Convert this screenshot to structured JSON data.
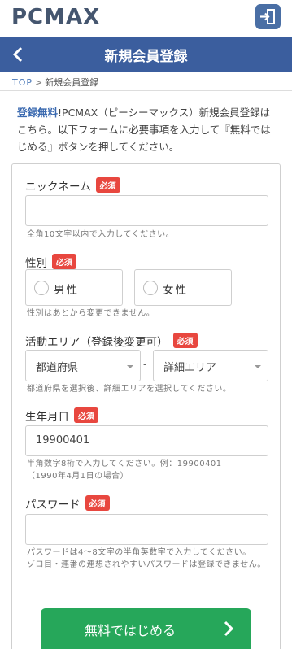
{
  "brand": {
    "logo_text": "PCMAX",
    "accent_color": "#3b5e9e",
    "submit_color": "#26a75a",
    "required_color": "#e8473f"
  },
  "header": {
    "title": "新規会員登録",
    "back_icon": "chevron-left-icon",
    "login_icon": "login-icon"
  },
  "breadcrumb": {
    "home": "TOP",
    "separator": ">",
    "current": "新規会員登録"
  },
  "intro": {
    "free_label": "登録無料",
    "text": "!PCMAX（ピーシーマックス）新規会員登録はこちら。以下フォームに必要事項を入力して『無料ではじめる』ボタンを押してください。"
  },
  "required_badge": "必須",
  "form": {
    "nickname": {
      "label": "ニックネーム",
      "value": "",
      "help": "全角10文字以内で入力してください。"
    },
    "gender": {
      "label": "性別",
      "options": [
        "男性",
        "女性"
      ],
      "help": "性別はあとから変更できません。"
    },
    "area": {
      "label": "活動エリア（登録後変更可）",
      "prefecture_selected": "都道府県",
      "detail_selected": "詳細エリア",
      "separator": "-",
      "help": "都道府県を選択後、詳細エリアを選択してください。"
    },
    "birthday": {
      "label": "生年月日",
      "placeholder": "19900401",
      "help_line1": "半角数字8桁で入力してください。例：19900401",
      "help_line2": "（1990年4月1日の場合）"
    },
    "password": {
      "label": "パスワード",
      "value": "",
      "help_line1": "パスワードは4～8文字の半角英数字で入力してください。",
      "help_line2": "ゾロ目・連番の連想されやすいパスワードは登録できません。"
    }
  },
  "submit": {
    "label": "無料ではじめる",
    "icon": "chevron-right-icon"
  }
}
